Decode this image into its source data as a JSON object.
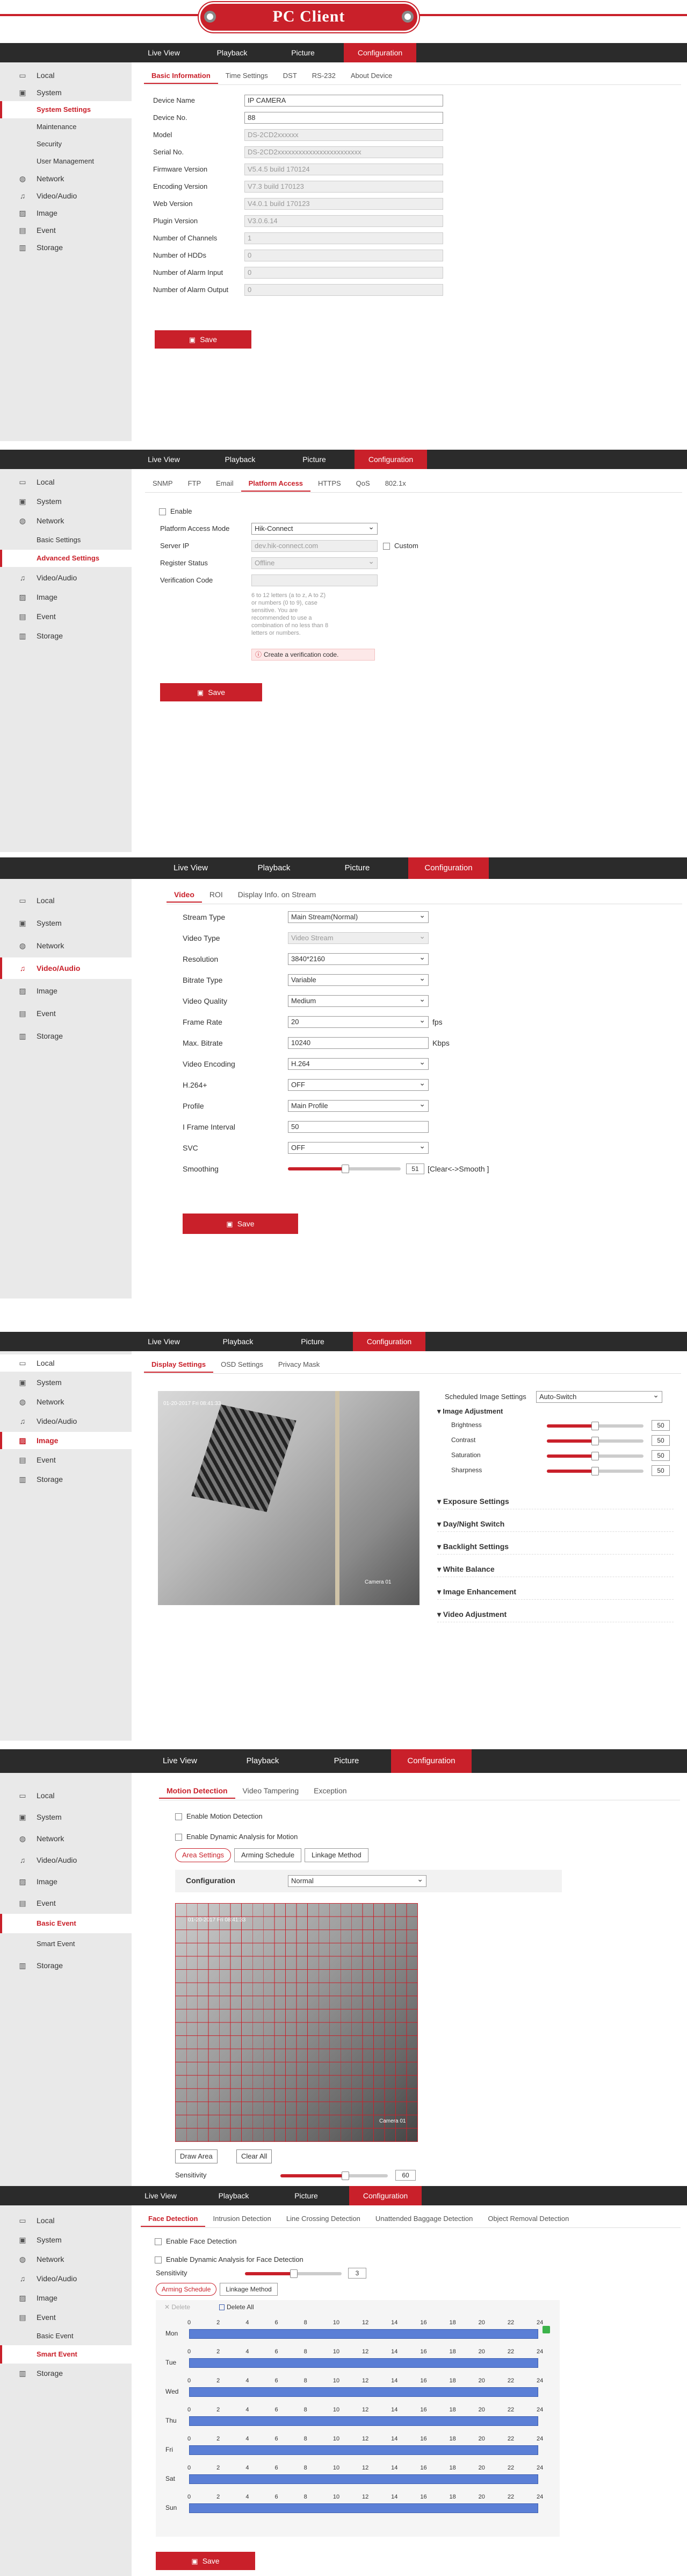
{
  "banner_title": "PC Client",
  "nav": [
    "Live View",
    "Playback",
    "Picture",
    "Configuration"
  ],
  "colors": {
    "accent": "#c9202a",
    "nav_bg": "#2b2b2b",
    "sidebar_bg": "#e9e9e9",
    "schedule_bar": "#5b7fd6"
  },
  "s1": {
    "sidebar": [
      "Local",
      "System",
      "System Settings",
      "Maintenance",
      "Security",
      "User Management",
      "Network",
      "Video/Audio",
      "Image",
      "Event",
      "Storage"
    ],
    "tabs": [
      "Basic Information",
      "Time Settings",
      "DST",
      "RS-232",
      "About Device"
    ],
    "fields": [
      {
        "label": "Device Name",
        "value": "IP CAMERA"
      },
      {
        "label": "Device No.",
        "value": "88"
      },
      {
        "label": "Model",
        "value": "DS-2CD2xxxxxx"
      },
      {
        "label": "Serial No.",
        "value": "DS-2CD2xxxxxxxxxxxxxxxxxxxxxxxx"
      },
      {
        "label": "Firmware Version",
        "value": "V5.4.5 build 170124"
      },
      {
        "label": "Encoding Version",
        "value": "V7.3 build 170123"
      },
      {
        "label": "Web Version",
        "value": "V4.0.1 build 170123"
      },
      {
        "label": "Plugin Version",
        "value": "V3.0.6.14"
      },
      {
        "label": "Number of Channels",
        "value": "1"
      },
      {
        "label": "Number of HDDs",
        "value": "0"
      },
      {
        "label": "Number of Alarm Input",
        "value": "0"
      },
      {
        "label": "Number of Alarm Output",
        "value": "0"
      }
    ],
    "save": "Save"
  },
  "s2": {
    "sidebar": [
      "Local",
      "System",
      "Network",
      "Basic Settings",
      "Advanced Settings",
      "Video/Audio",
      "Image",
      "Event",
      "Storage"
    ],
    "tabs": [
      "SNMP",
      "FTP",
      "Email",
      "Platform Access",
      "HTTPS",
      "QoS",
      "802.1x"
    ],
    "enable": "Enable",
    "fields": [
      {
        "label": "Platform Access Mode",
        "value": "Hik-Connect"
      },
      {
        "label": "Server IP",
        "value": "dev.hik-connect.com"
      },
      {
        "label": "Register Status",
        "value": "Offline"
      },
      {
        "label": "Verification Code",
        "value": ""
      }
    ],
    "custom": "Custom",
    "hint": "6 to 12 letters (a to z, A to Z) or numbers (0 to 9), case sensitive. You are recommended to use a combination of no less than 8 letters or numbers.",
    "create_code": "Create a verification code.",
    "save": "Save"
  },
  "s3": {
    "sidebar": [
      "Local",
      "System",
      "Network",
      "Video/Audio",
      "Image",
      "Event",
      "Storage"
    ],
    "tabs": [
      "Video",
      "ROI",
      "Display Info. on Stream"
    ],
    "fields": [
      {
        "label": "Stream Type",
        "value": "Main Stream(Normal)"
      },
      {
        "label": "Video Type",
        "value": "Video Stream"
      },
      {
        "label": "Resolution",
        "value": "3840*2160"
      },
      {
        "label": "Bitrate Type",
        "value": "Variable"
      },
      {
        "label": "Video Quality",
        "value": "Medium"
      },
      {
        "label": "Frame Rate",
        "value": "20"
      },
      {
        "label": "Max. Bitrate",
        "value": "10240"
      },
      {
        "label": "Video Encoding",
        "value": "H.264"
      },
      {
        "label": "H.264+",
        "value": "OFF"
      },
      {
        "label": "Profile",
        "value": "Main Profile"
      },
      {
        "label": "I Frame Interval",
        "value": "50"
      },
      {
        "label": "SVC",
        "value": "OFF"
      },
      {
        "label": "Smoothing",
        "value": "51"
      }
    ],
    "fps_unit": "fps",
    "kbps_unit": "Kbps",
    "smooth_hint": "[Clear<->Smooth ]",
    "smoothing_level": 0.51,
    "save": "Save"
  },
  "s4": {
    "sidebar": [
      "Local",
      "System",
      "Network",
      "Video/Audio",
      "Image",
      "Event",
      "Storage"
    ],
    "tabs": [
      "Display Settings",
      "OSD Settings",
      "Privacy Mask"
    ],
    "osd_text": "01-20-2017 Fri 08:41:33",
    "cam_label": "Camera 01",
    "sched_label": "Scheduled Image Settings",
    "sched_value": "Auto-Switch",
    "image_adj": "Image Adjustment",
    "sliders": [
      {
        "label": "Brightness",
        "value": "50"
      },
      {
        "label": "Contrast",
        "value": "50"
      },
      {
        "label": "Saturation",
        "value": "50"
      },
      {
        "label": "Sharpness",
        "value": "50"
      }
    ],
    "sections": [
      "Exposure Settings",
      "Day/Night Switch",
      "Backlight Settings",
      "White Balance",
      "Image Enhancement",
      "Video Adjustment"
    ]
  },
  "s5": {
    "sidebar": [
      "Local",
      "System",
      "Network",
      "Video/Audio",
      "Image",
      "Event",
      "Basic Event",
      "Smart Event",
      "Storage"
    ],
    "tabs": [
      "Motion Detection",
      "Video Tampering",
      "Exception"
    ],
    "enable_motion": "Enable Motion Detection",
    "enable_dynamic": "Enable Dynamic Analysis for Motion",
    "subtabs": [
      "Area Settings",
      "Arming Schedule",
      "Linkage Method"
    ],
    "config_label": "Configuration",
    "config_value": "Normal",
    "osd_text": "01-20-2017 Fri 08:41:33",
    "cam_label": "Camera 01",
    "draw_area": "Draw Area",
    "clear_all": "Clear All",
    "sensitivity": "Sensitivity",
    "sensitivity_value": "60"
  },
  "s6": {
    "sidebar": [
      "Local",
      "System",
      "Network",
      "Video/Audio",
      "Image",
      "Event",
      "Basic Event",
      "Smart Event",
      "Storage"
    ],
    "tabs": [
      "Face Detection",
      "Intrusion Detection",
      "Line Crossing Detection",
      "Unattended Baggage Detection",
      "Object Removal Detection"
    ],
    "enable_face": "Enable Face Detection",
    "enable_dynamic": "Enable Dynamic Analysis for Face Detection",
    "sensitivity": "Sensitivity",
    "sensitivity_value": "3",
    "subtabs": [
      "Arming Schedule",
      "Linkage Method"
    ],
    "delete": "Delete",
    "delete_all": "Delete All",
    "days": [
      "Mon",
      "Tue",
      "Wed",
      "Thu",
      "Fri",
      "Sat",
      "Sun"
    ],
    "hours": [
      "0",
      "2",
      "4",
      "6",
      "8",
      "10",
      "12",
      "14",
      "16",
      "18",
      "20",
      "22",
      "24"
    ],
    "save": "Save"
  }
}
